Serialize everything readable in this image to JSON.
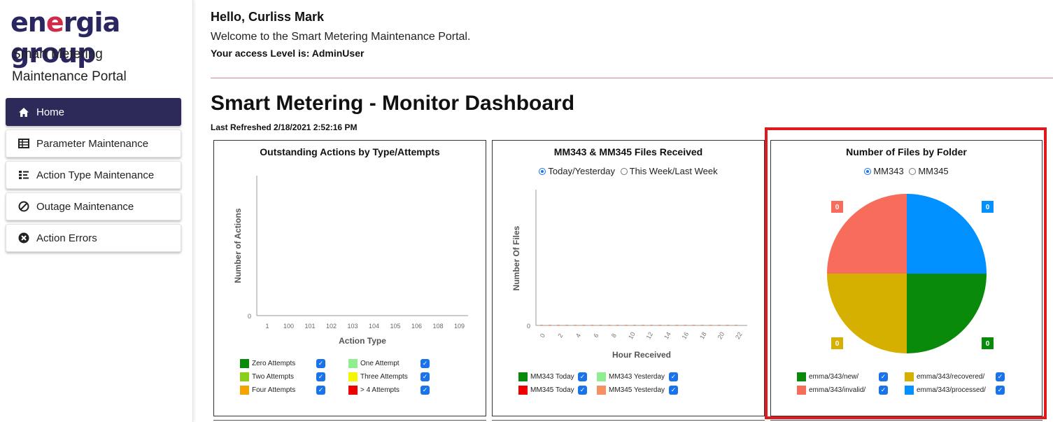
{
  "brand": {
    "logo_pre": "en",
    "logo_accent": "e",
    "logo_post": "rgia group",
    "line1": "Smart Metering",
    "line2": "Maintenance Portal"
  },
  "nav": [
    {
      "label": "Home",
      "icon": "home-icon",
      "active": true
    },
    {
      "label": "Parameter Maintenance",
      "icon": "table-icon",
      "active": false
    },
    {
      "label": "Action Type Maintenance",
      "icon": "list-icon",
      "active": false
    },
    {
      "label": "Outage Maintenance",
      "icon": "ban-icon",
      "active": false
    },
    {
      "label": "Action Errors",
      "icon": "error-circle-icon",
      "active": false
    }
  ],
  "header": {
    "hello": "Hello, Curliss Mark",
    "welcome": "Welcome to the Smart Metering Maintenance Portal.",
    "access": "Your access Level is: AdminUser"
  },
  "dashboard": {
    "title": "Smart Metering - Monitor Dashboard",
    "refreshed": "Last Refreshed 2/18/2021 2:52:16 PM"
  },
  "panels": {
    "outstanding": {
      "title": "Outstanding Actions by Type/Attempts",
      "legend": [
        {
          "label": "Zero Attempts",
          "color": "#0a8a0a"
        },
        {
          "label": "One Attempt",
          "color": "#90ee90"
        },
        {
          "label": "Two Attempts",
          "color": "#8ccf1a"
        },
        {
          "label": "Three Attempts",
          "color": "#f5f500"
        },
        {
          "label": "Four Attempts",
          "color": "#f5a300"
        },
        {
          "label": "> 4 Attempts",
          "color": "#ee0000"
        }
      ]
    },
    "files_received": {
      "title": "MM343 & MM345 Files Received",
      "radio_a": "Today/Yesterday",
      "radio_b": "This Week/Last Week",
      "legend": [
        {
          "label": "MM343 Today",
          "color": "#0a8a0a"
        },
        {
          "label": "MM343 Yesterday",
          "color": "#90ee90"
        },
        {
          "label": "MM345 Today",
          "color": "#ee0000"
        },
        {
          "label": "MM345 Yesterday",
          "color": "#f79060"
        }
      ]
    },
    "by_folder": {
      "title": "Number of Files by Folder",
      "radio_a": "MM343",
      "radio_b": "MM345",
      "legend": [
        {
          "label": "emma/343/new/",
          "color": "#0a8a0a"
        },
        {
          "label": "emma/343/recovered/",
          "color": "#d6b000"
        },
        {
          "label": "emma/343/invalid/",
          "color": "#f76c5a"
        },
        {
          "label": "emma/343/processed/",
          "color": "#0090ff"
        }
      ]
    }
  },
  "chart_data": [
    {
      "type": "bar",
      "title": "Outstanding Actions by Type/Attempts",
      "xlabel": "Action Type",
      "ylabel": "Number of Actions",
      "categories": [
        "1",
        "100",
        "101",
        "102",
        "103",
        "104",
        "105",
        "106",
        "108",
        "109"
      ],
      "y_ticks": [
        "0"
      ],
      "series": [
        {
          "name": "Zero Attempts",
          "values": [
            0,
            0,
            0,
            0,
            0,
            0,
            0,
            0,
            0,
            0
          ]
        },
        {
          "name": "One Attempt",
          "values": [
            0,
            0,
            0,
            0,
            0,
            0,
            0,
            0,
            0,
            0
          ]
        },
        {
          "name": "Two Attempts",
          "values": [
            0,
            0,
            0,
            0,
            0,
            0,
            0,
            0,
            0,
            0
          ]
        },
        {
          "name": "Three Attempts",
          "values": [
            0,
            0,
            0,
            0,
            0,
            0,
            0,
            0,
            0,
            0
          ]
        },
        {
          "name": "Four Attempts",
          "values": [
            0,
            0,
            0,
            0,
            0,
            0,
            0,
            0,
            0,
            0
          ]
        },
        {
          "name": "> 4 Attempts",
          "values": [
            0,
            0,
            0,
            0,
            0,
            0,
            0,
            0,
            0,
            0
          ]
        }
      ]
    },
    {
      "type": "bar",
      "title": "MM343 & MM345 Files Received",
      "xlabel": "Hour Received",
      "ylabel": "Number Of Files",
      "x_ticks": [
        "0",
        "2",
        "4",
        "6",
        "8",
        "10",
        "12",
        "14",
        "16",
        "18",
        "20",
        "22"
      ],
      "y_ticks": [
        "0"
      ],
      "series": [
        {
          "name": "MM343 Today",
          "values": [
            0,
            0,
            0,
            0,
            0,
            0,
            0,
            0,
            0,
            0,
            0,
            0
          ]
        },
        {
          "name": "MM343 Yesterday",
          "values": [
            0,
            0,
            0,
            0,
            0,
            0,
            0,
            0,
            0,
            0,
            0,
            0
          ]
        },
        {
          "name": "MM345 Today",
          "values": [
            0,
            0,
            0,
            0,
            0,
            0,
            0,
            0,
            0,
            0,
            0,
            0
          ]
        },
        {
          "name": "MM345 Yesterday",
          "values": [
            0,
            0,
            0,
            0,
            0,
            0,
            0,
            0,
            0,
            0,
            0,
            0
          ]
        }
      ]
    },
    {
      "type": "pie",
      "title": "Number of Files by Folder",
      "slices": [
        {
          "label": "emma/343/processed/",
          "value": 0,
          "color": "#0090ff",
          "display": "0"
        },
        {
          "label": "emma/343/new/",
          "value": 0,
          "color": "#0a8a0a",
          "display": "0"
        },
        {
          "label": "emma/343/recovered/",
          "value": 0,
          "color": "#d6b000",
          "display": "0"
        },
        {
          "label": "emma/343/invalid/",
          "value": 0,
          "color": "#f76c5a",
          "display": "0"
        }
      ]
    }
  ]
}
